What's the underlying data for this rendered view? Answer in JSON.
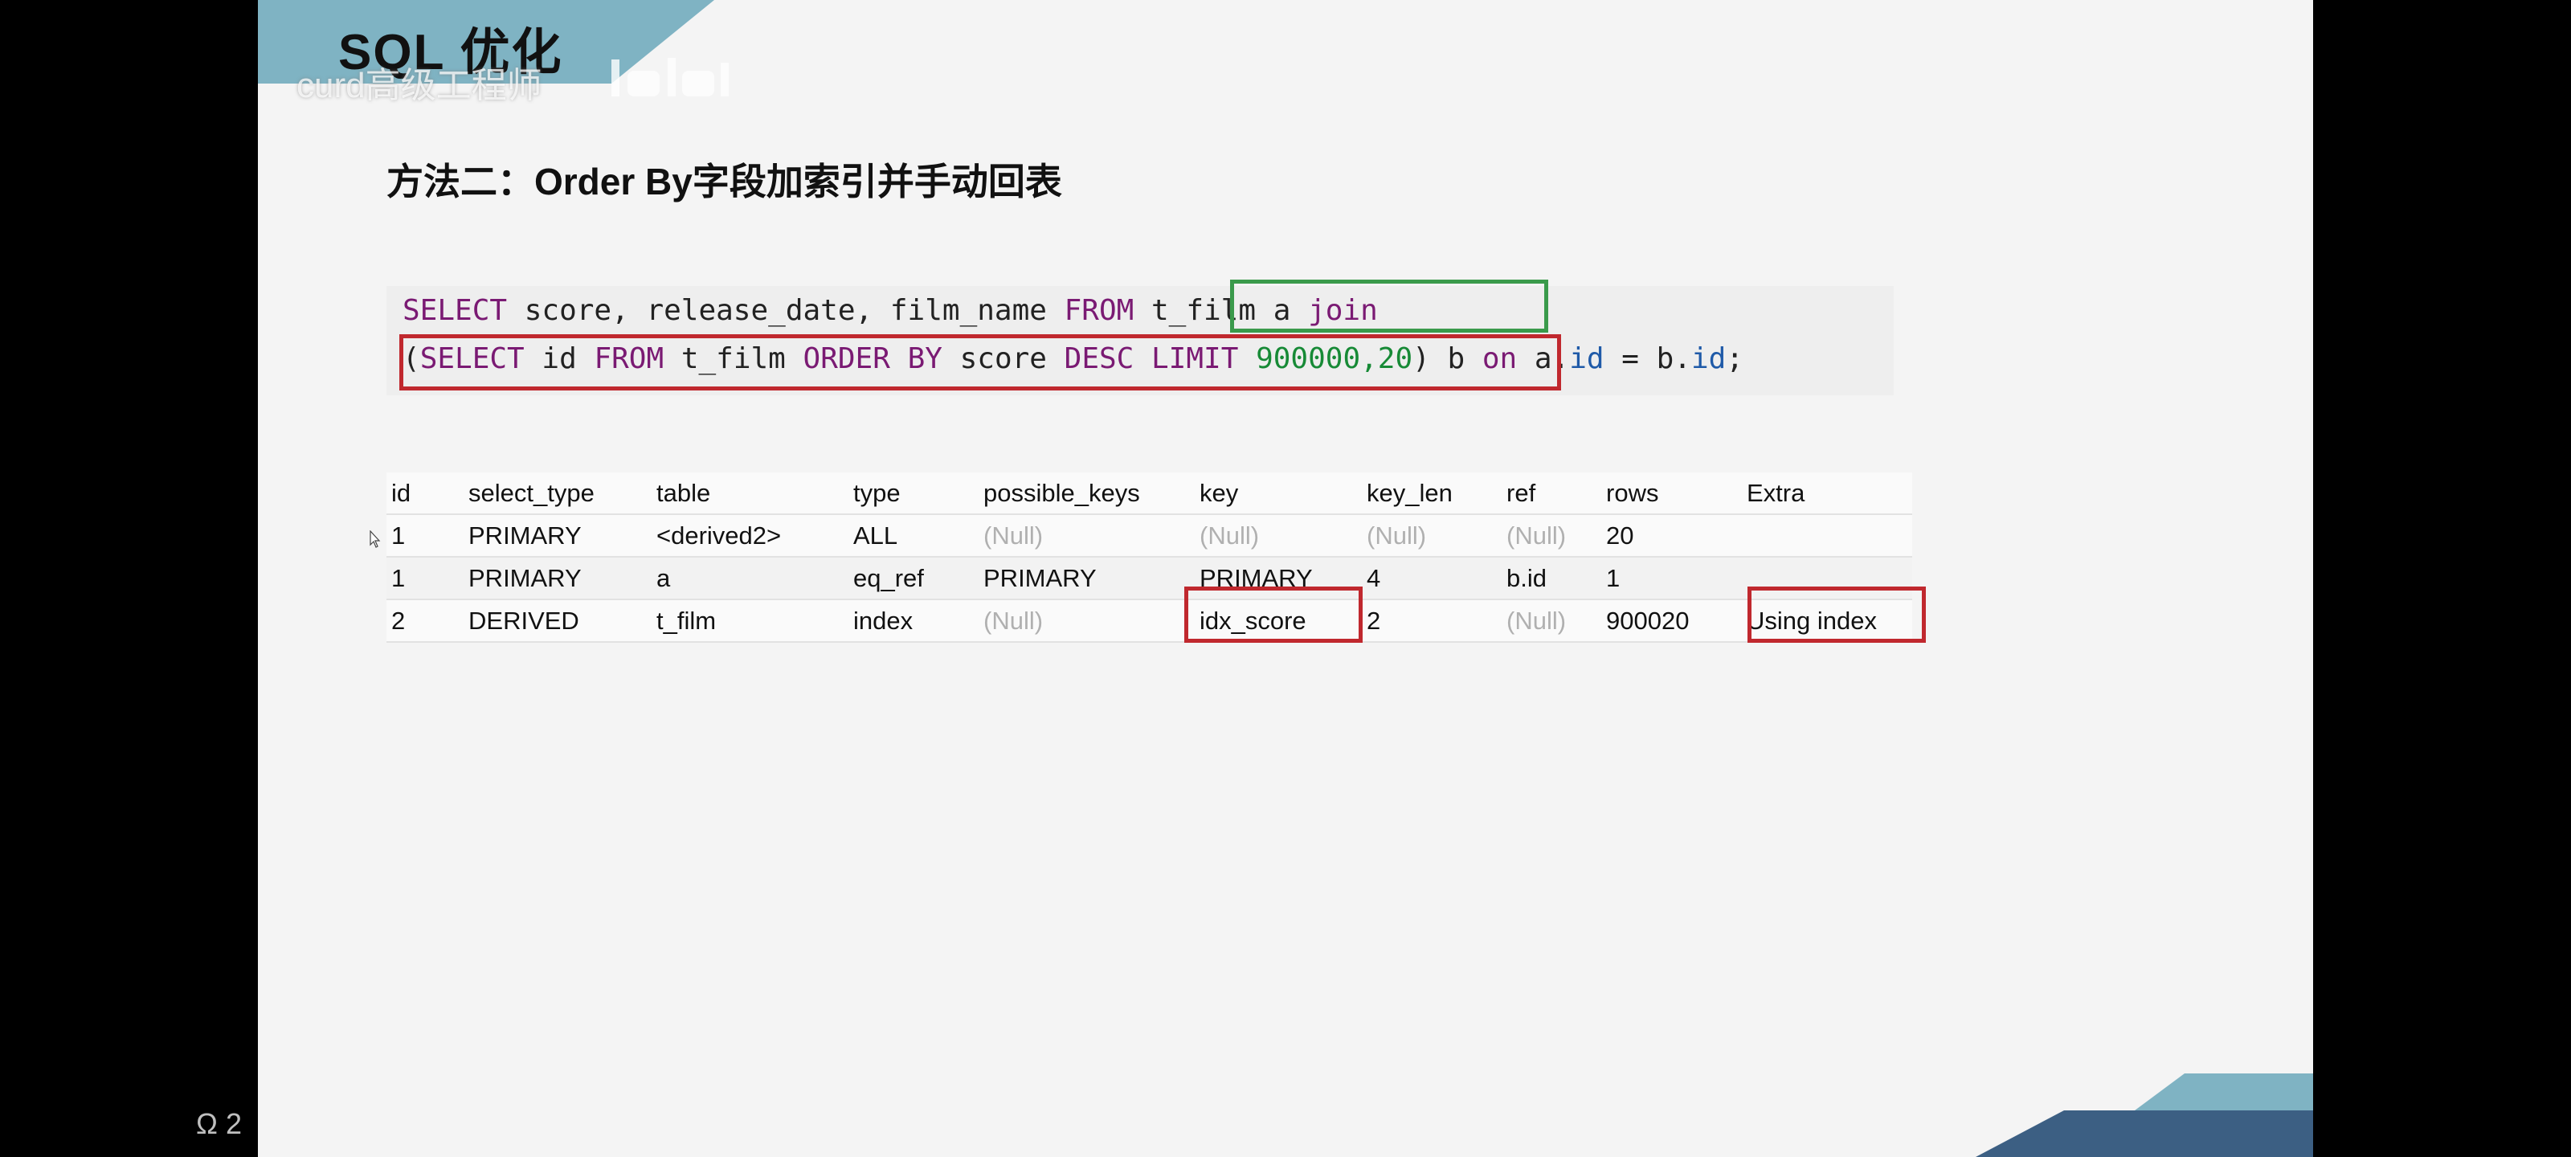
{
  "slide": {
    "title": "SQL 优化",
    "watermark": "curd高级工程师",
    "heading": "方法二：Order By字段加索引并手动回表"
  },
  "code": {
    "line1": {
      "t1": "SELECT",
      "t2": " score, release_date, film_name ",
      "t3": "FROM",
      "t4": " t_film a ",
      "t5": "join"
    },
    "line2": {
      "t1": "(",
      "t2": "SELECT",
      "t3": " id ",
      "t4": "FROM",
      "t5": " t_film ",
      "t6": "ORDER BY",
      "t7": " score ",
      "t8": "DESC LIMIT",
      "t9": " ",
      "t10": "900000,20",
      "t11": ") b ",
      "t12": "on",
      "t13": " a.",
      "t14": "id",
      "t15": " = b.",
      "t16": "id",
      "t17": ";"
    }
  },
  "explain_table": {
    "headers": [
      "id",
      "select_type",
      "table",
      "type",
      "possible_keys",
      "key",
      "key_len",
      "ref",
      "rows",
      "Extra"
    ],
    "rows": [
      [
        "1",
        "PRIMARY",
        "<derived2>",
        "ALL",
        "(Null)",
        "(Null)",
        "(Null)",
        "(Null)",
        "20",
        ""
      ],
      [
        "1",
        "PRIMARY",
        "a",
        "eq_ref",
        "PRIMARY",
        "PRIMARY",
        "4",
        "b.id",
        "1",
        ""
      ],
      [
        "2",
        "DERIVED",
        "t_film",
        "index",
        "(Null)",
        "idx_score",
        "2",
        "(Null)",
        "900020",
        "Using index"
      ]
    ]
  },
  "colors": {
    "banner": "#7fb3c3",
    "keyword": "#7a1a73",
    "number": "#178a36",
    "highlight_green": "#3a9a4b",
    "highlight_red": "#c0282e",
    "footer_dark": "#3c5f83"
  },
  "side_icon": "user-group-icon",
  "side_icon_digit": "2"
}
